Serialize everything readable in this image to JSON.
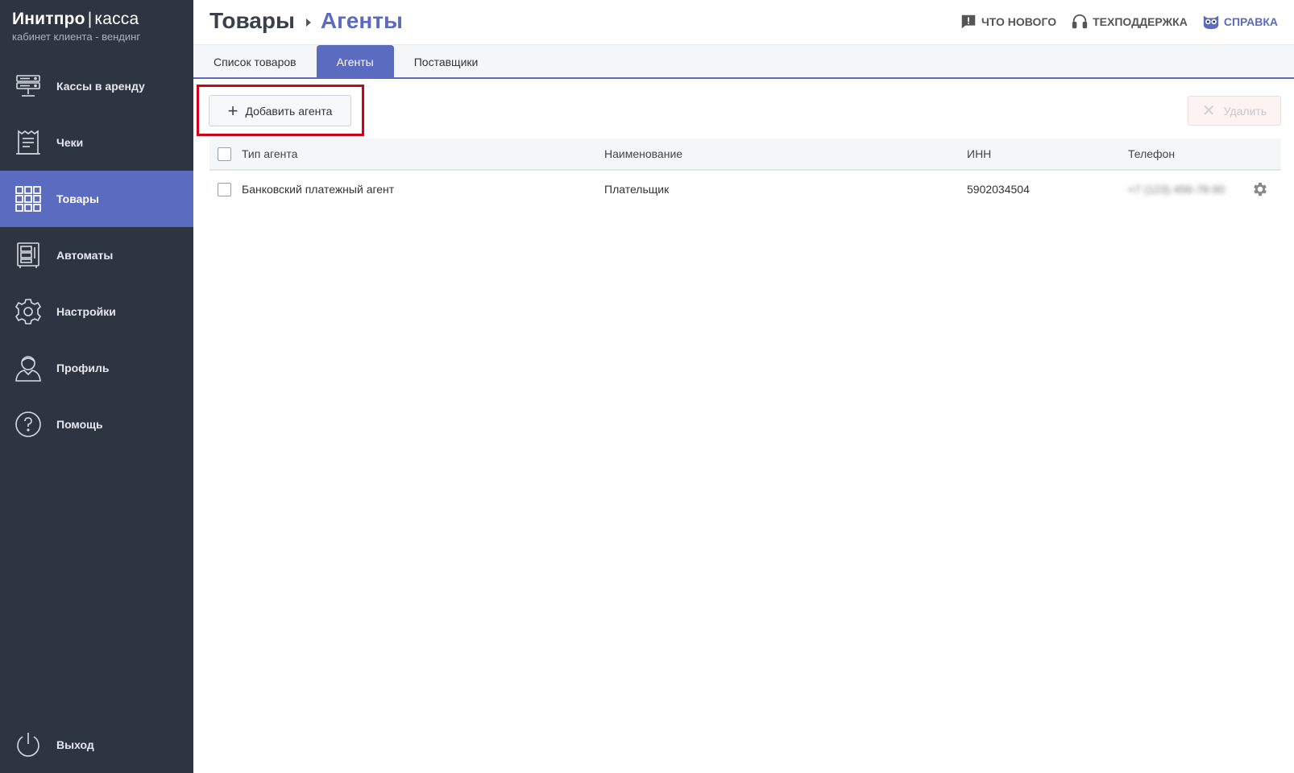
{
  "brand": {
    "name_bold": "Инитпро",
    "separator": "|",
    "name_light": "касса",
    "subtitle": "кабинет клиента - вендинг"
  },
  "sidebar": {
    "items": [
      {
        "label": "Кассы в аренду",
        "icon": "server-icon"
      },
      {
        "label": "Чеки",
        "icon": "receipt-icon"
      },
      {
        "label": "Товары",
        "icon": "grid-icon",
        "active": true
      },
      {
        "label": "Автоматы",
        "icon": "vending-machine-icon"
      },
      {
        "label": "Настройки",
        "icon": "gear-icon"
      },
      {
        "label": "Профиль",
        "icon": "user-icon"
      },
      {
        "label": "Помощь",
        "icon": "help-icon"
      }
    ],
    "logout_label": "Выход"
  },
  "header": {
    "crumb_root": "Товары",
    "crumb_current": "Агенты",
    "links": {
      "whats_new": "ЧТО НОВОГО",
      "support": "ТЕХПОДДЕРЖКА",
      "help": "СПРАВКА"
    }
  },
  "tabs": [
    {
      "label": "Список товаров"
    },
    {
      "label": "Агенты",
      "active": true
    },
    {
      "label": "Поставщики"
    }
  ],
  "toolbar": {
    "add_label": "Добавить агента",
    "delete_label": "Удалить"
  },
  "table": {
    "columns": [
      "Тип агента",
      "Наименование",
      "ИНН",
      "Телефон"
    ],
    "rows": [
      {
        "type": "Банковский платежный агент",
        "name": "Плательщик",
        "inn": "5902034504",
        "phone": "+7 (123) 456-78-90"
      }
    ]
  },
  "colors": {
    "sidebar_bg": "#2f3441",
    "accent": "#5b6bbf",
    "highlight": "#d0021b"
  }
}
